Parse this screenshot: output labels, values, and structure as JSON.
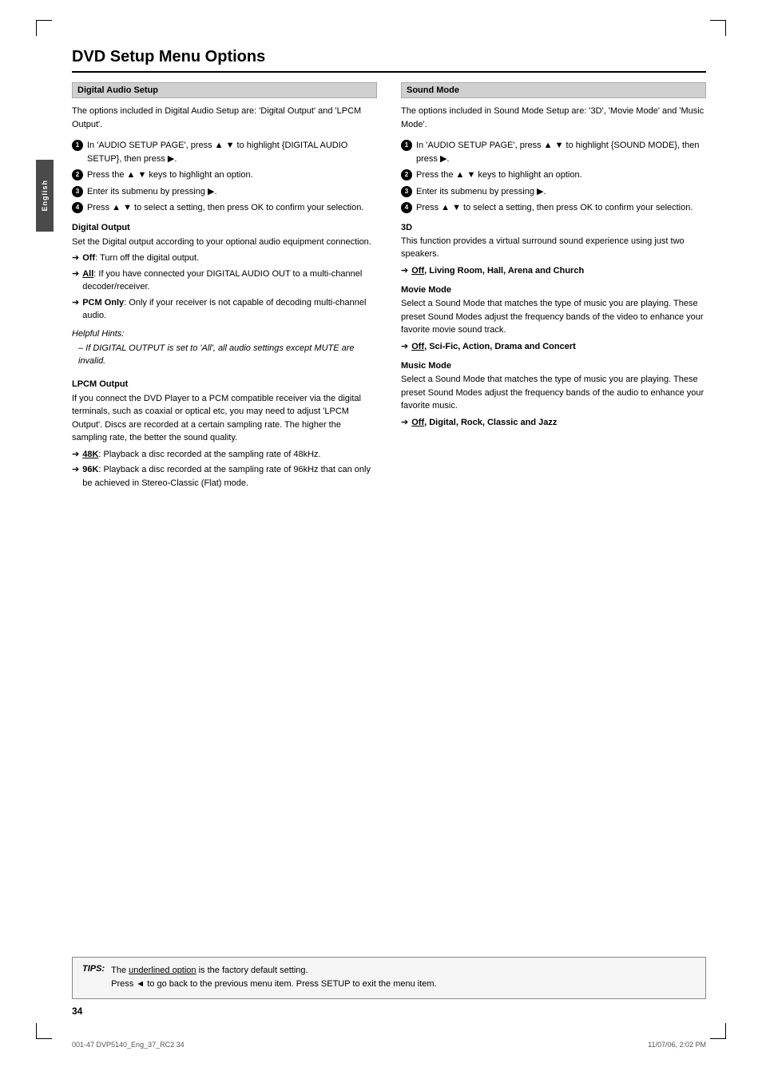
{
  "page": {
    "title": "DVD Setup Menu Options",
    "page_number": "34",
    "footer_left": "001-47 DVP5140_Eng_37_RC2          34",
    "footer_right": "11/07/06, 2:02 PM"
  },
  "side_tab": {
    "label": "English"
  },
  "left_column": {
    "section_title": "Digital Audio Setup",
    "intro": "The options included in Digital Audio Setup are: 'Digital Output' and 'LPCM Output'.",
    "steps": [
      "In 'AUDIO SETUP PAGE', press ▲ ▼ to highlight {DIGITAL AUDIO SETUP}, then press ▶.",
      "Press the ▲ ▼ keys to highlight an option.",
      "Enter its submenu by pressing ▶.",
      "Press ▲ ▼ to select a setting, then press OK to confirm your selection."
    ],
    "digital_output": {
      "heading": "Digital Output",
      "desc": "Set the Digital output according to your optional audio equipment connection.",
      "options": [
        {
          "label": "Off",
          "bold": true,
          "text": ": Turn off the digital output."
        },
        {
          "label": "All",
          "bold": true,
          "underline": true,
          "text": ": If you have connected your DIGITAL AUDIO OUT to a multi-channel decoder/receiver."
        },
        {
          "label": "PCM Only",
          "bold": true,
          "text": ": Only if your receiver is not capable of decoding multi-channel audio."
        }
      ],
      "helpful_hints_label": "Helpful Hints:",
      "helpful_hints_text": "– If DIGITAL OUTPUT is set to 'All', all audio settings except MUTE are invalid."
    },
    "lpcm_output": {
      "heading": "LPCM Output",
      "desc": "If you connect the DVD Player to a PCM compatible receiver via the digital terminals, such as coaxial or optical etc, you may need to adjust 'LPCM Output'. Discs are recorded at a certain sampling rate. The higher the sampling rate, the better the sound quality.",
      "options": [
        {
          "label": "48K",
          "bold": true,
          "underline": true,
          "text": ": Playback a disc recorded at the sampling rate of 48kHz."
        },
        {
          "label": "96K",
          "bold": true,
          "text": ": Playback a disc recorded at the sampling rate of 96kHz that can only be achieved in Stereo-Classic (Flat) mode."
        }
      ]
    }
  },
  "right_column": {
    "section_title": "Sound Mode",
    "intro": "The options included in Sound Mode Setup are: '3D', 'Movie Mode' and 'Music Mode'.",
    "steps": [
      "In 'AUDIO SETUP PAGE', press ▲ ▼ to highlight {SOUND MODE}, then press ▶.",
      "Press the ▲ ▼ keys to highlight an option.",
      "Enter its submenu by pressing ▶.",
      "Press ▲ ▼ to select a setting, then press OK to confirm your selection."
    ],
    "mode_3d": {
      "heading": "3D",
      "desc": "This function provides a virtual surround sound experience using just two speakers.",
      "options_text": "Off, Living Room, Hall, Arena and Church",
      "options_label": "Off"
    },
    "movie_mode": {
      "heading": "Movie Mode",
      "desc": "Select a Sound Mode that matches the type of music you are playing. These preset Sound Modes adjust the frequency bands of the video to enhance your favorite movie sound track.",
      "options_text": "Off, Sci-Fic, Action, Drama and Concert",
      "options_label": "Off"
    },
    "music_mode": {
      "heading": "Music Mode",
      "desc": "Select a Sound Mode that matches the type of music you are playing. These preset Sound Modes adjust the frequency bands of the audio to enhance your favorite music.",
      "options_text": "Off, Digital, Rock, Classic and Jazz",
      "options_label": "Off"
    }
  },
  "tips": {
    "label": "TIPS:",
    "line1": "The underlined option is the factory default setting.",
    "line2": "Press ◄ to go back to the previous menu item. Press SETUP to exit the menu item."
  }
}
